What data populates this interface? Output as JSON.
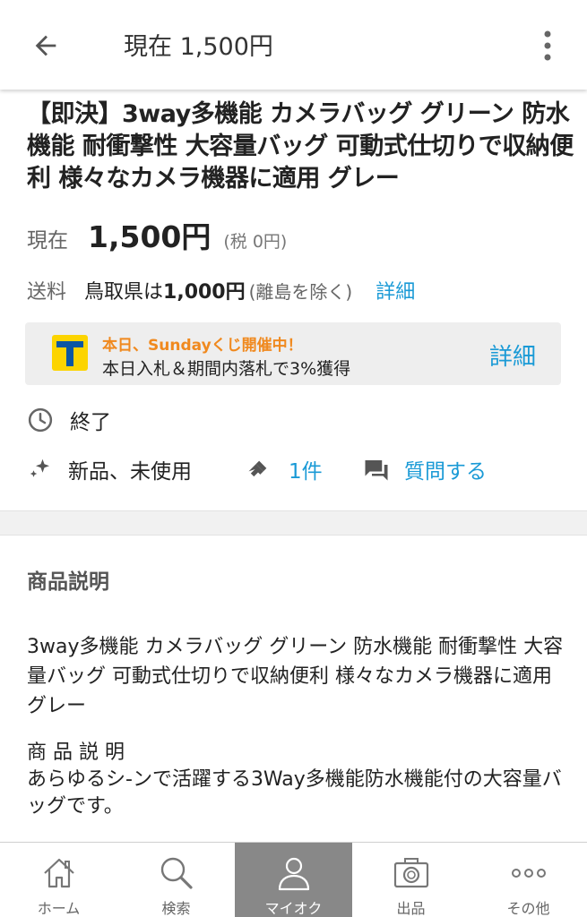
{
  "appbar": {
    "title": "現在 1,500円"
  },
  "item": {
    "title": "【即決】3way多機能 カメラバッグ グリーン 防水機能 耐衝撃性 大容量バッグ 可動式仕切りで収納便利 様々なカメラ機器に適用 グレー"
  },
  "price": {
    "label": "現在",
    "value": "1,500円",
    "tax": "(税 0円)"
  },
  "shipping": {
    "label": "送料",
    "area": "鳥取県は",
    "amount": "1,000円",
    "note": "(離島を除く)",
    "link": "詳細"
  },
  "promo": {
    "line1": "本日、Sundayくじ開催中！",
    "line2": "本日入札＆期間内落札で3%獲得",
    "link": "詳細",
    "accent": "#f0891e"
  },
  "status": {
    "text": "終了"
  },
  "meta": {
    "condition": "新品、未使用",
    "bids": "1件",
    "question": "質問する"
  },
  "description": {
    "heading": "商品説明",
    "body": "3way多機能 カメラバッグ グリーン 防水機能 耐衝撃性 大容量バッグ 可動式仕切りで収納便利 様々なカメラ機器に適用 グレー",
    "sub_heading": "商 品 説 明",
    "sub_body": "あらゆるシ-ンで活躍する3Way多機能防水機能付の大容量バッグです。"
  },
  "tabs": [
    {
      "label": "ホーム",
      "icon": "home-icon"
    },
    {
      "label": "検索",
      "icon": "search-icon"
    },
    {
      "label": "マイオク",
      "icon": "person-icon"
    },
    {
      "label": "出品",
      "icon": "camera-icon"
    },
    {
      "label": "その他",
      "icon": "more-dots-icon"
    }
  ],
  "colors": {
    "link": "#1a9ad6",
    "active_tab": "#888888"
  }
}
